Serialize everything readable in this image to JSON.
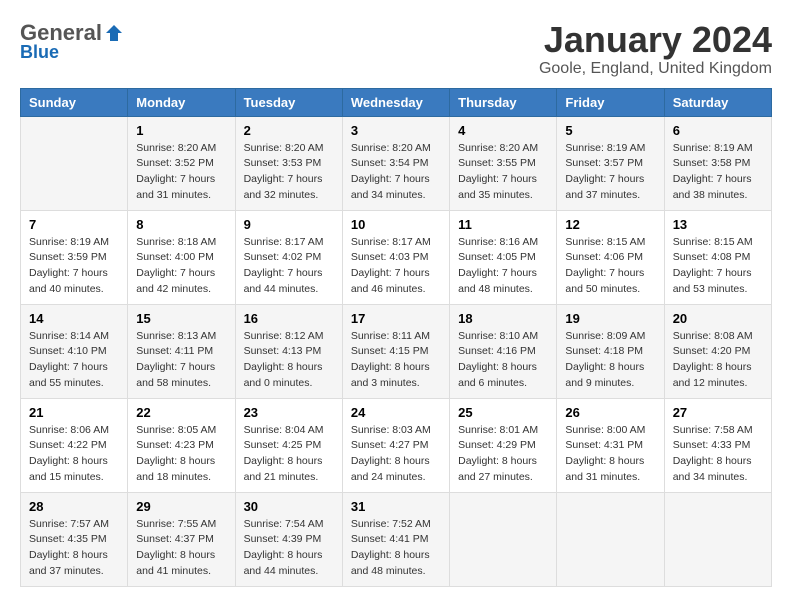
{
  "header": {
    "logo": {
      "general": "General",
      "blue": "Blue"
    },
    "title": "January 2024",
    "location": "Goole, England, United Kingdom"
  },
  "weekdays": [
    "Sunday",
    "Monday",
    "Tuesday",
    "Wednesday",
    "Thursday",
    "Friday",
    "Saturday"
  ],
  "weeks": [
    [
      {
        "day": "",
        "sunrise": "",
        "sunset": "",
        "daylight": ""
      },
      {
        "day": "1",
        "sunrise": "Sunrise: 8:20 AM",
        "sunset": "Sunset: 3:52 PM",
        "daylight": "Daylight: 7 hours and 31 minutes."
      },
      {
        "day": "2",
        "sunrise": "Sunrise: 8:20 AM",
        "sunset": "Sunset: 3:53 PM",
        "daylight": "Daylight: 7 hours and 32 minutes."
      },
      {
        "day": "3",
        "sunrise": "Sunrise: 8:20 AM",
        "sunset": "Sunset: 3:54 PM",
        "daylight": "Daylight: 7 hours and 34 minutes."
      },
      {
        "day": "4",
        "sunrise": "Sunrise: 8:20 AM",
        "sunset": "Sunset: 3:55 PM",
        "daylight": "Daylight: 7 hours and 35 minutes."
      },
      {
        "day": "5",
        "sunrise": "Sunrise: 8:19 AM",
        "sunset": "Sunset: 3:57 PM",
        "daylight": "Daylight: 7 hours and 37 minutes."
      },
      {
        "day": "6",
        "sunrise": "Sunrise: 8:19 AM",
        "sunset": "Sunset: 3:58 PM",
        "daylight": "Daylight: 7 hours and 38 minutes."
      }
    ],
    [
      {
        "day": "7",
        "sunrise": "Sunrise: 8:19 AM",
        "sunset": "Sunset: 3:59 PM",
        "daylight": "Daylight: 7 hours and 40 minutes."
      },
      {
        "day": "8",
        "sunrise": "Sunrise: 8:18 AM",
        "sunset": "Sunset: 4:00 PM",
        "daylight": "Daylight: 7 hours and 42 minutes."
      },
      {
        "day": "9",
        "sunrise": "Sunrise: 8:17 AM",
        "sunset": "Sunset: 4:02 PM",
        "daylight": "Daylight: 7 hours and 44 minutes."
      },
      {
        "day": "10",
        "sunrise": "Sunrise: 8:17 AM",
        "sunset": "Sunset: 4:03 PM",
        "daylight": "Daylight: 7 hours and 46 minutes."
      },
      {
        "day": "11",
        "sunrise": "Sunrise: 8:16 AM",
        "sunset": "Sunset: 4:05 PM",
        "daylight": "Daylight: 7 hours and 48 minutes."
      },
      {
        "day": "12",
        "sunrise": "Sunrise: 8:15 AM",
        "sunset": "Sunset: 4:06 PM",
        "daylight": "Daylight: 7 hours and 50 minutes."
      },
      {
        "day": "13",
        "sunrise": "Sunrise: 8:15 AM",
        "sunset": "Sunset: 4:08 PM",
        "daylight": "Daylight: 7 hours and 53 minutes."
      }
    ],
    [
      {
        "day": "14",
        "sunrise": "Sunrise: 8:14 AM",
        "sunset": "Sunset: 4:10 PM",
        "daylight": "Daylight: 7 hours and 55 minutes."
      },
      {
        "day": "15",
        "sunrise": "Sunrise: 8:13 AM",
        "sunset": "Sunset: 4:11 PM",
        "daylight": "Daylight: 7 hours and 58 minutes."
      },
      {
        "day": "16",
        "sunrise": "Sunrise: 8:12 AM",
        "sunset": "Sunset: 4:13 PM",
        "daylight": "Daylight: 8 hours and 0 minutes."
      },
      {
        "day": "17",
        "sunrise": "Sunrise: 8:11 AM",
        "sunset": "Sunset: 4:15 PM",
        "daylight": "Daylight: 8 hours and 3 minutes."
      },
      {
        "day": "18",
        "sunrise": "Sunrise: 8:10 AM",
        "sunset": "Sunset: 4:16 PM",
        "daylight": "Daylight: 8 hours and 6 minutes."
      },
      {
        "day": "19",
        "sunrise": "Sunrise: 8:09 AM",
        "sunset": "Sunset: 4:18 PM",
        "daylight": "Daylight: 8 hours and 9 minutes."
      },
      {
        "day": "20",
        "sunrise": "Sunrise: 8:08 AM",
        "sunset": "Sunset: 4:20 PM",
        "daylight": "Daylight: 8 hours and 12 minutes."
      }
    ],
    [
      {
        "day": "21",
        "sunrise": "Sunrise: 8:06 AM",
        "sunset": "Sunset: 4:22 PM",
        "daylight": "Daylight: 8 hours and 15 minutes."
      },
      {
        "day": "22",
        "sunrise": "Sunrise: 8:05 AM",
        "sunset": "Sunset: 4:23 PM",
        "daylight": "Daylight: 8 hours and 18 minutes."
      },
      {
        "day": "23",
        "sunrise": "Sunrise: 8:04 AM",
        "sunset": "Sunset: 4:25 PM",
        "daylight": "Daylight: 8 hours and 21 minutes."
      },
      {
        "day": "24",
        "sunrise": "Sunrise: 8:03 AM",
        "sunset": "Sunset: 4:27 PM",
        "daylight": "Daylight: 8 hours and 24 minutes."
      },
      {
        "day": "25",
        "sunrise": "Sunrise: 8:01 AM",
        "sunset": "Sunset: 4:29 PM",
        "daylight": "Daylight: 8 hours and 27 minutes."
      },
      {
        "day": "26",
        "sunrise": "Sunrise: 8:00 AM",
        "sunset": "Sunset: 4:31 PM",
        "daylight": "Daylight: 8 hours and 31 minutes."
      },
      {
        "day": "27",
        "sunrise": "Sunrise: 7:58 AM",
        "sunset": "Sunset: 4:33 PM",
        "daylight": "Daylight: 8 hours and 34 minutes."
      }
    ],
    [
      {
        "day": "28",
        "sunrise": "Sunrise: 7:57 AM",
        "sunset": "Sunset: 4:35 PM",
        "daylight": "Daylight: 8 hours and 37 minutes."
      },
      {
        "day": "29",
        "sunrise": "Sunrise: 7:55 AM",
        "sunset": "Sunset: 4:37 PM",
        "daylight": "Daylight: 8 hours and 41 minutes."
      },
      {
        "day": "30",
        "sunrise": "Sunrise: 7:54 AM",
        "sunset": "Sunset: 4:39 PM",
        "daylight": "Daylight: 8 hours and 44 minutes."
      },
      {
        "day": "31",
        "sunrise": "Sunrise: 7:52 AM",
        "sunset": "Sunset: 4:41 PM",
        "daylight": "Daylight: 8 hours and 48 minutes."
      },
      {
        "day": "",
        "sunrise": "",
        "sunset": "",
        "daylight": ""
      },
      {
        "day": "",
        "sunrise": "",
        "sunset": "",
        "daylight": ""
      },
      {
        "day": "",
        "sunrise": "",
        "sunset": "",
        "daylight": ""
      }
    ]
  ]
}
